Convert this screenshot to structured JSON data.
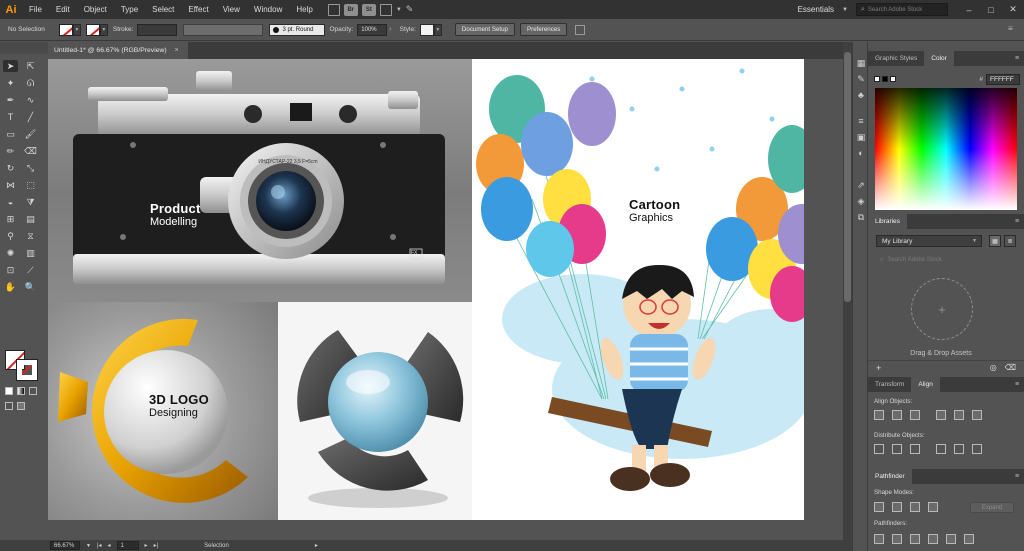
{
  "app": {
    "logo": "Ai",
    "menu": [
      "File",
      "Edit",
      "Object",
      "Type",
      "Select",
      "Effect",
      "View",
      "Window",
      "Help"
    ],
    "bridge_chip": "Br",
    "stock_chip": "St",
    "workspace": "Essentials",
    "search_placeholder": "Search Adobe Stock"
  },
  "control_bar": {
    "selection": "No Selection",
    "stroke_label": "Stroke:",
    "stroke_style": "3 pt. Round",
    "opacity_label": "Opacity:",
    "opacity_value": "100%",
    "style_label": "Style:",
    "document_setup": "Document Setup",
    "preferences": "Preferences"
  },
  "document": {
    "tab_title": "Untitled-1* @ 66.67% (RGB/Preview)",
    "close_glyph": "×"
  },
  "artboard": {
    "camera_label_1": "Product",
    "camera_label_2": "Modelling",
    "camera_lens_text": "ИНДУСТАР-22  3,5  F=5cm",
    "camera_badge": "FX",
    "cartoon_label_1": "Cartoon",
    "cartoon_label_2": "Graphics",
    "logo_label_1": "3D LOGO",
    "logo_label_2": "Designing"
  },
  "status_bar": {
    "zoom": "66.67%",
    "artboard_num": "1",
    "tool": "Selection"
  },
  "panels": {
    "graphic_styles_tab": "Graphic Styles",
    "color_tab": "Color",
    "hex_prefix": "#",
    "hex_value": "FFFFFF",
    "libraries_tab": "Libraries",
    "library_name": "My Library",
    "library_search_placeholder": "Search Adobe Stock",
    "drag_drop_text": "Drag & Drop Assets",
    "transform_tab": "Transform",
    "align_tab": "Align",
    "align_objects_label": "Align Objects:",
    "distribute_objects_label": "Distribute Objects:",
    "pathfinder_tab": "Pathfinder",
    "shape_modes_label": "Shape Modes:",
    "expand_button": "Expand",
    "pathfinders_label": "Pathfinders:"
  },
  "colors": {
    "accent_ai": "#ff9a00",
    "ui_dark": "#323232",
    "ui_mid": "#535353",
    "no_color_red": "#e02020"
  }
}
